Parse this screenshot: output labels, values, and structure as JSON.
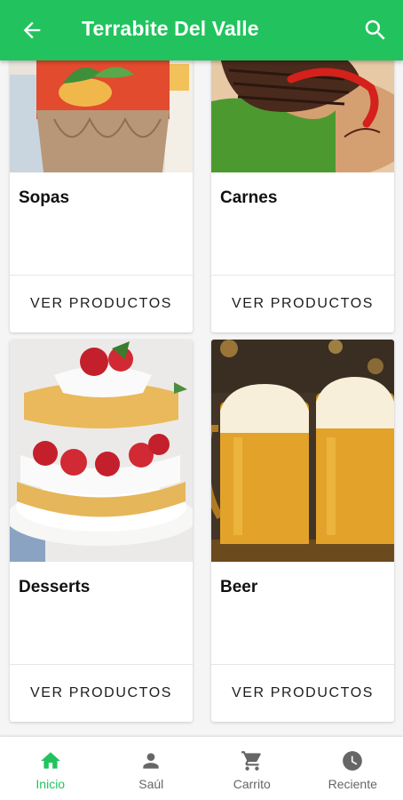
{
  "app": {
    "title": "Terrabite Del Valle",
    "accent_color": "#22c35e",
    "back_icon": "arrow-left-icon",
    "search_icon": "search-icon"
  },
  "categories": [
    {
      "name": "Sopas",
      "button_label": "VER PRODUCTOS",
      "image": "soup-bowl-image"
    },
    {
      "name": "Carnes",
      "button_label": "VER PRODUCTOS",
      "image": "grilled-steak-image"
    },
    {
      "name": "Desserts",
      "button_label": "VER PRODUCTOS",
      "image": "strawberry-shortcake-image"
    },
    {
      "name": "Beer",
      "button_label": "VER PRODUCTOS",
      "image": "beer-mugs-image"
    }
  ],
  "bottom_nav": [
    {
      "label": "Inicio",
      "icon": "home-icon",
      "active": true
    },
    {
      "label": "Saúl",
      "icon": "person-icon",
      "active": false
    },
    {
      "label": "Carrito",
      "icon": "cart-icon",
      "active": false
    },
    {
      "label": "Reciente",
      "icon": "clock-icon",
      "active": false
    }
  ]
}
